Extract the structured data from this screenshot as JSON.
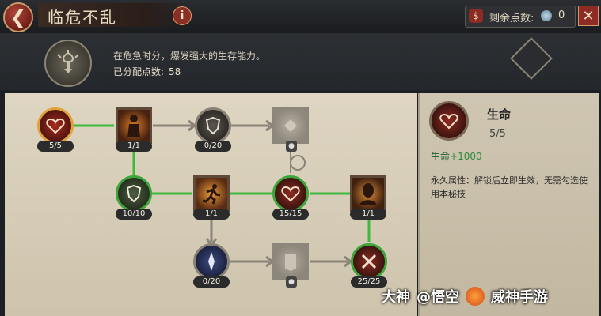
{
  "header": {
    "back_icon": "chevron-left-icon",
    "title": "临危不乱",
    "info_glyph": "i",
    "points_label": "剩余点数:",
    "points_value": "0",
    "close_glyph": "✕"
  },
  "info_panel": {
    "description": "在危急时分，爆发强大的生存能力。",
    "allocated_label": "已分配点数:",
    "allocated_value": "58"
  },
  "tree": {
    "nodes": [
      {
        "id": "life-1",
        "shape": "circle",
        "state": "maxed",
        "icon": "heart-icon",
        "count": "5/5"
      },
      {
        "id": "square-1",
        "shape": "square",
        "state": "active",
        "icon": "figure-icon",
        "count": "1/1"
      },
      {
        "id": "shield-top",
        "shape": "circle",
        "state": "unlocked",
        "icon": "shield-icon",
        "count": "0/20"
      },
      {
        "id": "locked-top",
        "shape": "square",
        "state": "locked",
        "icon": "lock-icon",
        "count": ""
      },
      {
        "id": "shield-mid",
        "shape": "circle",
        "state": "maxed",
        "icon": "shield-icon",
        "count": "10/10"
      },
      {
        "id": "sprint",
        "shape": "square",
        "state": "active",
        "icon": "sprint-icon",
        "count": "1/1"
      },
      {
        "id": "life-2",
        "shape": "circle",
        "state": "maxed",
        "icon": "heart-icon",
        "count": "15/15"
      },
      {
        "id": "head",
        "shape": "square",
        "state": "active",
        "icon": "head-icon",
        "count": "1/1"
      },
      {
        "id": "blade",
        "shape": "circle",
        "state": "unlocked",
        "icon": "blade-icon",
        "count": "0/20"
      },
      {
        "id": "locked-bottom",
        "shape": "square",
        "state": "locked",
        "icon": "lock-icon",
        "count": ""
      },
      {
        "id": "swords",
        "shape": "circle",
        "state": "maxed",
        "icon": "crossed-swords-icon",
        "count": "25/25"
      }
    ]
  },
  "detail": {
    "name": "生命",
    "level": "5/5",
    "stat_label": "生命",
    "stat_value": "+1000",
    "attr_text": "永久属性：解锁后立即生效，无需勾选使用本秘技"
  },
  "watermark": {
    "text1": "大神",
    "text2": "@悟空",
    "text3": "威神手游"
  },
  "colors": {
    "accent_red": "#8e2b22",
    "active_link": "#3dba3b",
    "inactive_link": "#8a8378",
    "maxed_ring": "#3da53a",
    "active_square": "#d97d2b"
  }
}
